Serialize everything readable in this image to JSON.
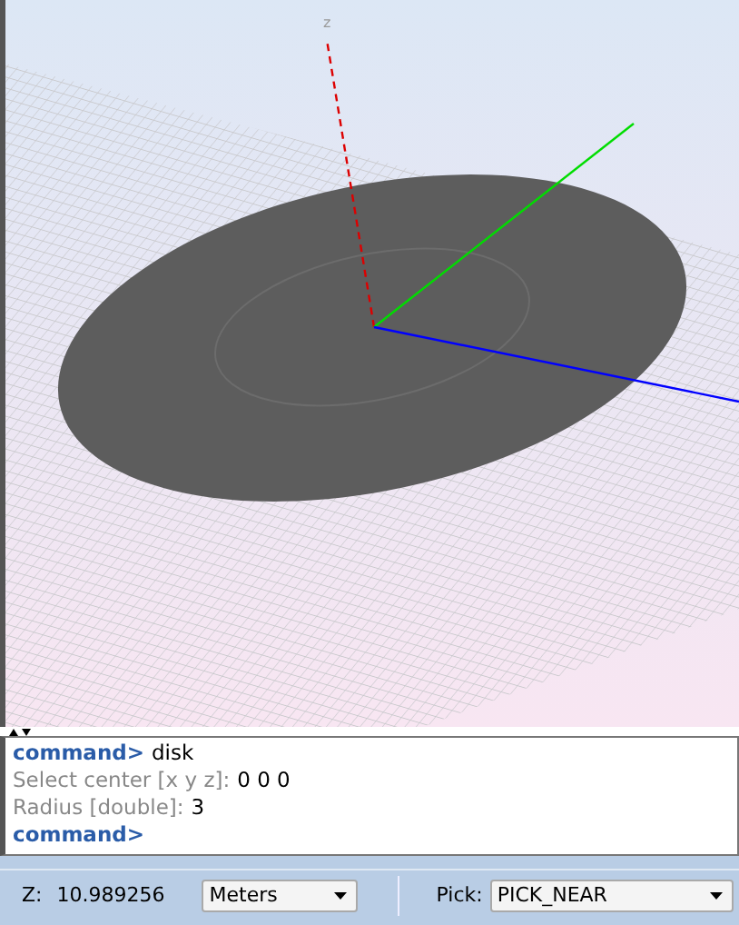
{
  "viewport": {
    "axis_label": "z"
  },
  "console": {
    "lines": [
      {
        "kind": "command",
        "label": "command>",
        "value": "disk"
      },
      {
        "kind": "prompt",
        "label": "Select center [x y z]:",
        "value": "0 0 0"
      },
      {
        "kind": "prompt",
        "label": "Radius [double]:",
        "value": "3"
      },
      {
        "kind": "command",
        "label": "command>"
      }
    ]
  },
  "status_bar": {
    "z_label": "Z:",
    "z_value": "10.989256",
    "units": "Meters",
    "pick_label": "Pick:",
    "pick": "PICK_NEAR"
  }
}
